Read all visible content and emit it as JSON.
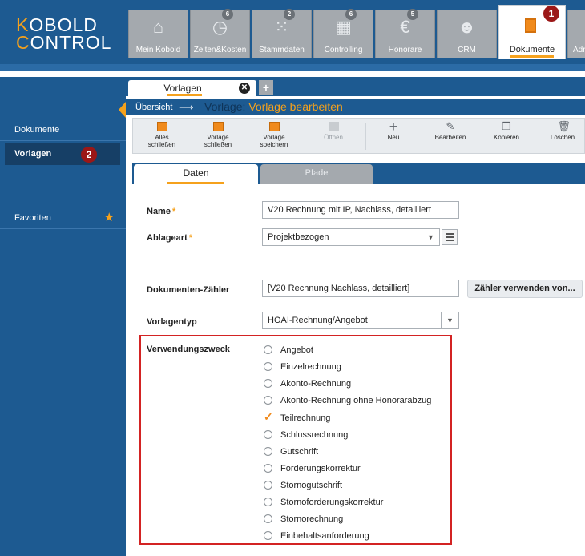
{
  "app": {
    "logo_line1_first": "K",
    "logo_line1_rest": "OBOLD",
    "logo_line2_first": "C",
    "logo_line2_rest": "ONTROL",
    "accent_color": "#f5a11c",
    "primary_color": "#1d5a91"
  },
  "modules": [
    {
      "label": "Mein Kobold",
      "icon": "home-icon",
      "badge": ""
    },
    {
      "label": "Zeiten&Kosten",
      "icon": "stopwatch-icon",
      "badge": "6"
    },
    {
      "label": "Stammdaten",
      "icon": "hierarchy-icon",
      "badge": "2"
    },
    {
      "label": "Controlling",
      "icon": "calculator-icon",
      "badge": "6"
    },
    {
      "label": "Honorare",
      "icon": "euro-coins-icon",
      "badge": "5"
    },
    {
      "label": "CRM",
      "icon": "people-icon",
      "badge": ""
    },
    {
      "label": "Dokumente",
      "icon": "documents-icon",
      "badge": "",
      "active": true
    },
    {
      "label": "Adr",
      "icon": "",
      "badge": ""
    }
  ],
  "callouts": {
    "one": "1",
    "two": "2"
  },
  "sidebar": {
    "items": [
      {
        "label": "Dokumente"
      },
      {
        "label": "Vorlagen",
        "selected": true
      },
      {
        "label": "Favoriten",
        "icon": "star-icon"
      }
    ]
  },
  "doc_tabs": {
    "active_label": "Vorlagen",
    "close_glyph": "✕",
    "add_glyph": "+"
  },
  "breadcrumb": {
    "link": "Übersicht",
    "arrow": "⟶",
    "title_prefix": "Vorlage:",
    "title": "Vorlage bearbeiten"
  },
  "toolbar": [
    {
      "line1": "Alles",
      "line2": "schließen",
      "icon": "folder-close-all-icon",
      "enabled": true
    },
    {
      "line1": "Vorlage",
      "line2": "schließen",
      "icon": "folder-close-icon",
      "enabled": true
    },
    {
      "line1": "Vorlage",
      "line2": "speichern",
      "icon": "save-icon",
      "enabled": true
    },
    {
      "line1": "Öffnen",
      "line2": "",
      "icon": "folder-open-icon",
      "enabled": false
    },
    {
      "line1": "Neu",
      "line2": "",
      "icon": "plus-icon",
      "enabled": true
    },
    {
      "line1": "Bearbeiten",
      "line2": "",
      "icon": "pencil-icon",
      "enabled": true
    },
    {
      "line1": "Kopieren",
      "line2": "",
      "icon": "copy-icon",
      "enabled": true
    },
    {
      "line1": "Löschen",
      "line2": "",
      "icon": "trash-icon",
      "enabled": true
    }
  ],
  "subtabs": {
    "active": "Daten",
    "inactive": "Pfade"
  },
  "form": {
    "name_label": "Name",
    "name_value": "V20 Rechnung mit IP, Nachlass, detailliert",
    "ablageart_label": "Ablageart",
    "ablageart_value": "Projektbezogen",
    "zaehler_label": "Dokumenten-Zähler",
    "zaehler_value": "[V20 Rechnung Nachlass, detailliert]",
    "zaehler_button": "Zähler verwenden von...",
    "vorlagentyp_label": "Vorlagentyp",
    "vorlagentyp_value": "HOAI-Rechnung/Angebot",
    "required_marker": "*",
    "dropdown_glyph": "▼",
    "verwendungszweck_label": "Verwendungszweck",
    "verwendungszweck_options": [
      {
        "label": "Angebot",
        "checked": false
      },
      {
        "label": "Einzelrechnung",
        "checked": false
      },
      {
        "label": "Akonto-Rechnung",
        "checked": false
      },
      {
        "label": "Akonto-Rechnung ohne Honorarabzug",
        "checked": false
      },
      {
        "label": "Teilrechnung",
        "checked": true
      },
      {
        "label": "Schlussrechnung",
        "checked": false
      },
      {
        "label": "Gutschrift",
        "checked": false
      },
      {
        "label": "Forderungskorrektur",
        "checked": false
      },
      {
        "label": "Stornogutschrift",
        "checked": false
      },
      {
        "label": "Stornoforderungskorrektur",
        "checked": false
      },
      {
        "label": "Stornorechnung",
        "checked": false
      },
      {
        "label": "Einbehaltsanforderung",
        "checked": false
      }
    ]
  }
}
